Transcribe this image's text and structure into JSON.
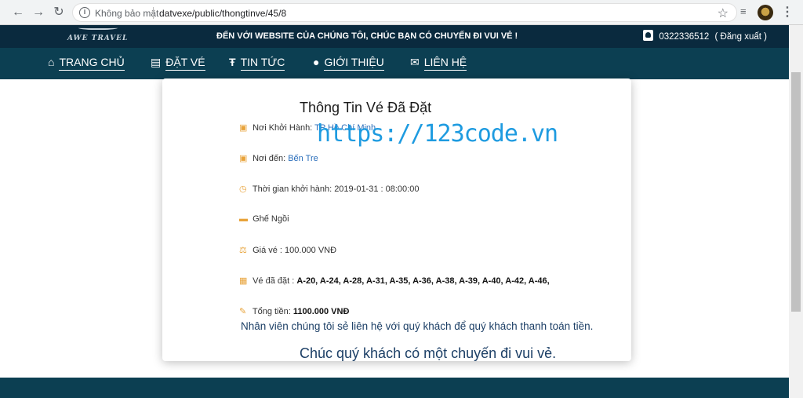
{
  "browser": {
    "security_label": "Không bảo mật",
    "url": "datvexe/public/thongtinve/45/8"
  },
  "header": {
    "logo_text": "AWE TRAVEL",
    "marquee": "ĐẾN VỚI WEBSITE CỦA CHÚNG TÔI, CHÚC BẠN CÓ CHUYẾN ĐI VUI VẺ !",
    "phone": "0322336512",
    "logout": "( Đăng xuất )"
  },
  "nav": {
    "items": [
      {
        "label": "TRANG CHỦ",
        "icon": "home-icon"
      },
      {
        "label": "ĐẶT VÉ",
        "icon": "list-icon"
      },
      {
        "label": "TIN TỨC",
        "icon": "text-icon"
      },
      {
        "label": "GIỚI THIỆU",
        "icon": "info-icon"
      },
      {
        "label": "LIÊN HỆ",
        "icon": "mail-icon"
      }
    ]
  },
  "ticket": {
    "title": "Thông Tin Vé Đã Đặt",
    "origin_label": "Nơi Khởi Hành:",
    "origin_value": "TP Hồ Chí Minh",
    "destination_label": "Nơi đến:",
    "destination_value": "Bến Tre",
    "departure_label": "Thời gian khởi hành:",
    "departure_value": "2019-01-31 : 08:00:00",
    "seat_type": "Ghế Ngồi",
    "price_label": "Giá vé :",
    "price_value": "100.000 VNĐ",
    "booked_label": "Vé đã đặt :",
    "booked_seats": "A-20, A-24, A-28, A-31, A-35, A-36, A-38, A-39, A-40, A-42, A-46,",
    "total_label": "Tổng tiền:",
    "total_value": "1100.000 VNĐ",
    "notice": "Nhân viên chúng tôi sẻ liên hệ với quý khách để quý khách thanh toán tiền.",
    "wish": "Chúc quý khách có một chuyến đi vui vẻ."
  },
  "watermark": "https://123code.vn",
  "colors": {
    "topbar": "#0a2a3e",
    "navbar": "#0c3f52",
    "accent_icon": "#e8a33a",
    "link": "#2a6ebb",
    "watermark": "#1e9be0"
  }
}
